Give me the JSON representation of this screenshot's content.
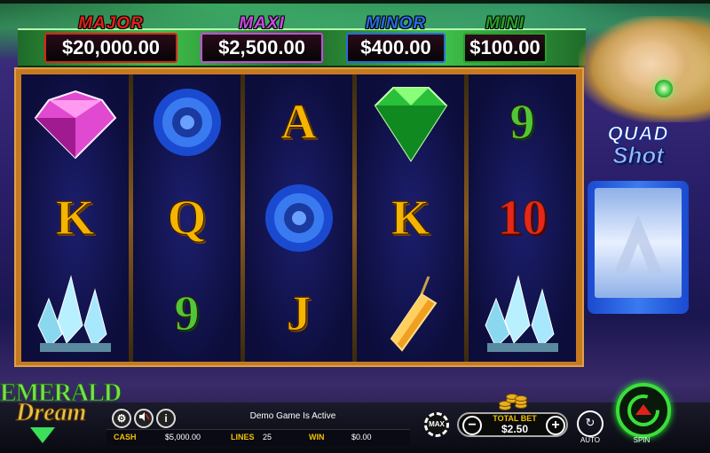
{
  "game": {
    "title_line1": "EMERALD",
    "title_line2": "Dream"
  },
  "jackpots": [
    {
      "name": "MAJOR",
      "amount": "$20,000.00",
      "name_color": "#e0211a",
      "border_color": "#e0211a"
    },
    {
      "name": "MAXI",
      "amount": "$2,500.00",
      "name_color": "#c84ae0",
      "border_color": "#c84ae0"
    },
    {
      "name": "MINOR",
      "amount": "$400.00",
      "name_color": "#2a6adf",
      "border_color": "#2a6adf"
    },
    {
      "name": "MINI",
      "amount": "$100.00",
      "name_color": "#2aa02a",
      "border_color": "#2aa02a"
    }
  ],
  "reels": [
    [
      {
        "symbol": "pink-diamond-icon"
      },
      {
        "symbol": "K",
        "color": "gold"
      },
      {
        "symbol": "crystal-cluster-icon"
      }
    ],
    [
      {
        "symbol": "blue-rose-icon"
      },
      {
        "symbol": "Q",
        "color": "gold"
      },
      {
        "symbol": "9",
        "color": "green"
      }
    ],
    [
      {
        "symbol": "A",
        "color": "gold"
      },
      {
        "symbol": "blue-rose-icon"
      },
      {
        "symbol": "J",
        "color": "gold"
      }
    ],
    [
      {
        "symbol": "emerald-icon"
      },
      {
        "symbol": "K",
        "color": "gold"
      },
      {
        "symbol": "amber-pendant-icon"
      }
    ],
    [
      {
        "symbol": "9",
        "color": "green"
      },
      {
        "symbol": "10",
        "color": "red"
      },
      {
        "symbol": "crystal-cluster-icon"
      }
    ]
  ],
  "quad_shot": {
    "line1": "QUAD",
    "line2": "Shot"
  },
  "status": {
    "message": "Demo Game Is Active"
  },
  "meters": {
    "cash_label": "CASH",
    "cash_value": "$5,000.00",
    "lines_label": "LINES",
    "lines_value": "25",
    "win_label": "WIN",
    "win_value": "$0.00"
  },
  "bet": {
    "label": "TOTAL BET",
    "value": "$2.50",
    "minus": "−",
    "plus": "+",
    "max_label": "MAX"
  },
  "controls": {
    "auto_label": "AUTO",
    "spin_label": "SPIN",
    "auto_glyph": "↻",
    "spin_glyph": "↻"
  },
  "utility_icons": {
    "settings": "⚙",
    "sound": "🔇",
    "info": "i"
  }
}
